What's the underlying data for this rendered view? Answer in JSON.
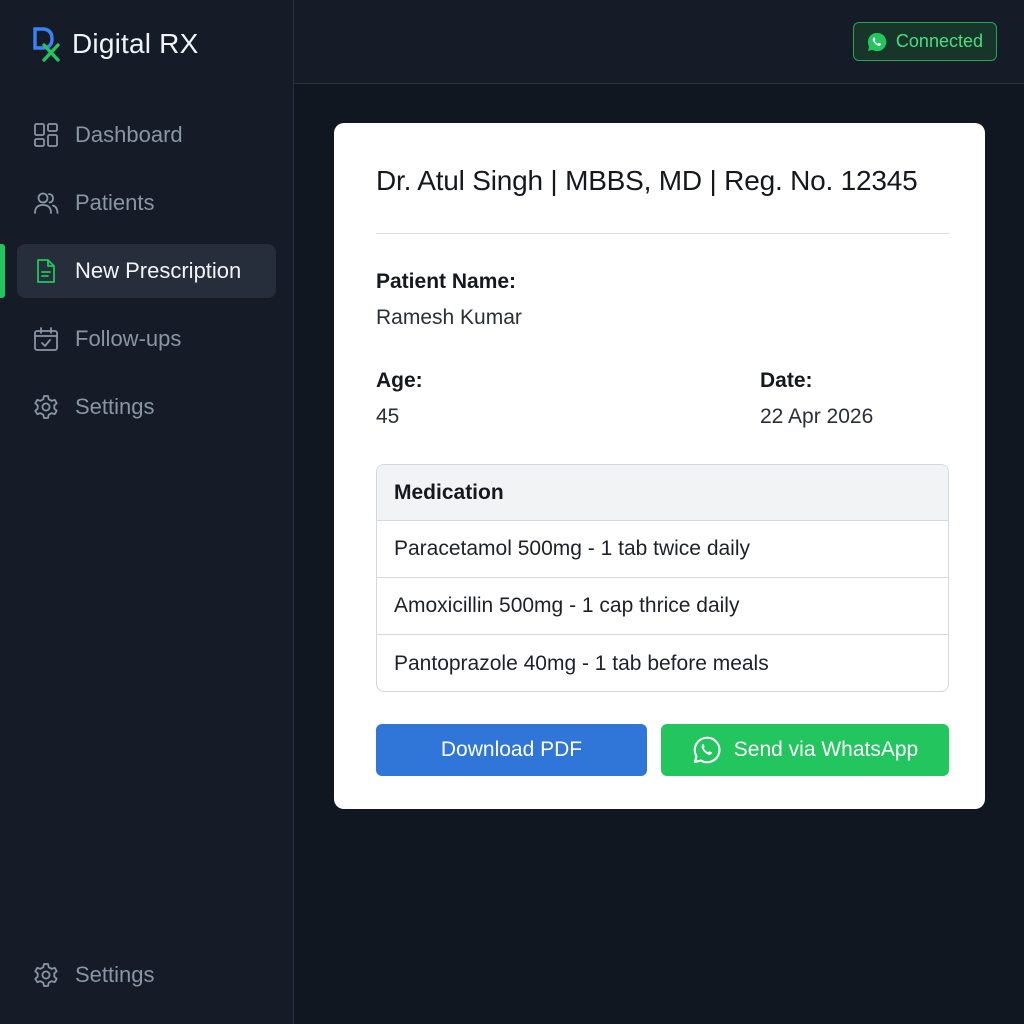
{
  "brand": {
    "name": "Digital RX"
  },
  "sidebar": {
    "items": [
      {
        "label": "Dashboard",
        "icon": "dashboard-icon"
      },
      {
        "label": "Patients",
        "icon": "users-icon"
      },
      {
        "label": "New Prescription",
        "icon": "document-icon",
        "active": true
      },
      {
        "label": "Follow-ups",
        "icon": "calendar-check-icon"
      },
      {
        "label": "Settings",
        "icon": "gear-icon"
      }
    ],
    "footer": {
      "label": "Settings",
      "icon": "gear-icon"
    }
  },
  "topbar": {
    "status_label": "Connected",
    "status_icon": "whatsapp-icon"
  },
  "prescription": {
    "doctor_line": "Dr. Atul Singh | MBBS, MD | Reg. No. 12345",
    "patient_name_label": "Patient Name:",
    "patient_name": "Ramesh Kumar",
    "age_label": "Age:",
    "age": "45",
    "date_label": "Date:",
    "date": "22 Apr 2026",
    "medication_header": "Medication",
    "medications": [
      "Paracetamol 500mg - 1 tab twice daily",
      "Amoxicillin 500mg - 1 cap thrice daily",
      "Pantoprazole 40mg - 1 tab before meals"
    ],
    "download_label": "Download PDF",
    "whatsapp_label": "Send via WhatsApp"
  },
  "colors": {
    "accent_green": "#22c55e",
    "accent_blue": "#2f76d8",
    "sidebar_bg": "#151c27",
    "main_bg": "#111720"
  }
}
